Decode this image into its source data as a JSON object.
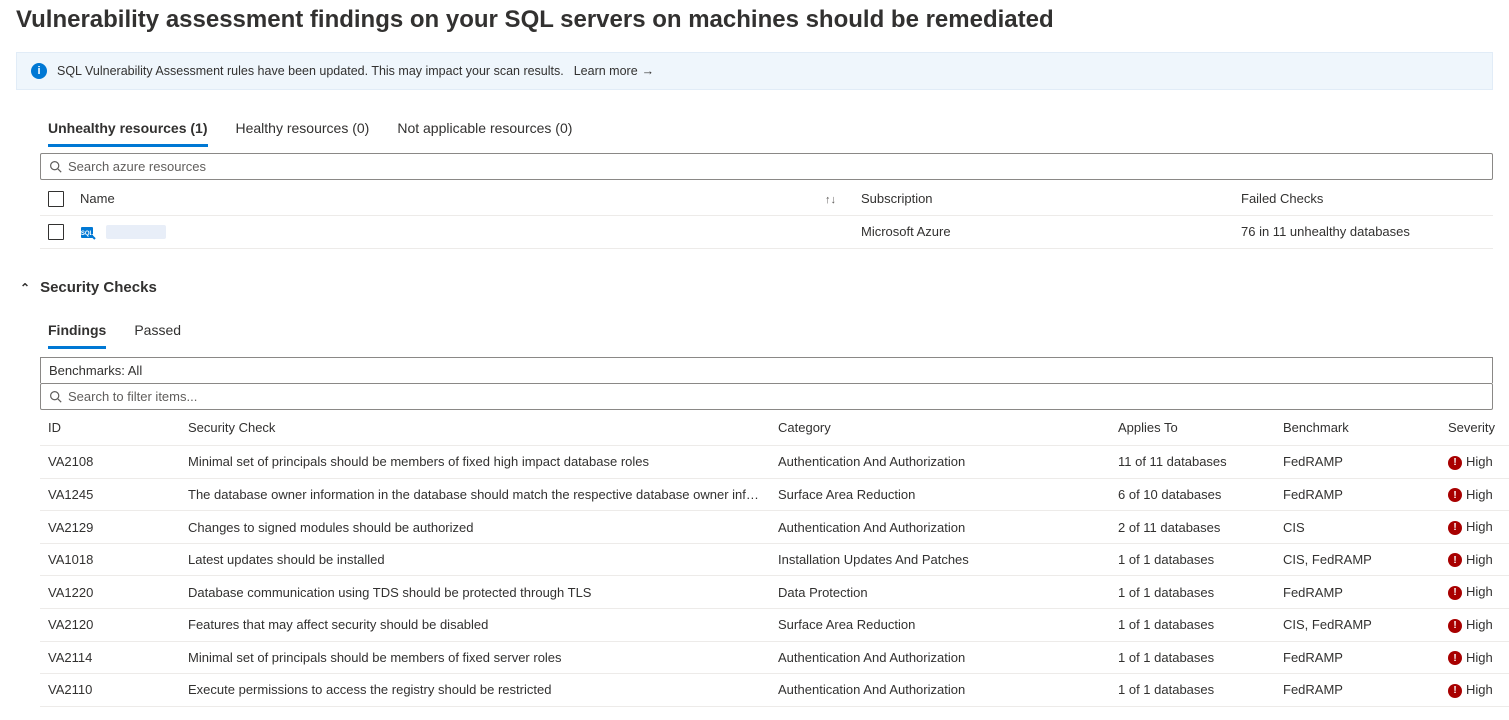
{
  "page_title": "Vulnerability assessment findings on your SQL servers on machines should be remediated",
  "info_banner": {
    "text": "SQL Vulnerability Assessment rules have been updated. This may impact your scan results.",
    "learn_more": "Learn more"
  },
  "resource_tabs": {
    "unhealthy": "Unhealthy resources (1)",
    "healthy": "Healthy resources (0)",
    "na": "Not applicable resources (0)"
  },
  "resource_search_placeholder": "Search azure resources",
  "resource_columns": {
    "name": "Name",
    "subscription": "Subscription",
    "failed": "Failed Checks"
  },
  "resource_row": {
    "subscription": "Microsoft Azure",
    "failed": "76 in 11 unhealthy databases"
  },
  "security_checks_heading": "Security Checks",
  "security_tabs": {
    "findings": "Findings",
    "passed": "Passed"
  },
  "benchmarks_label": "Benchmarks: All",
  "findings_search_placeholder": "Search to filter items...",
  "findings_columns": {
    "id": "ID",
    "security_check": "Security Check",
    "category": "Category",
    "applies_to": "Applies To",
    "benchmark": "Benchmark",
    "severity": "Severity"
  },
  "findings": [
    {
      "id": "VA2108",
      "security_check": "Minimal set of principals should be members of fixed high impact database roles",
      "category": "Authentication And Authorization",
      "applies_to": "11 of 11 databases",
      "benchmark": "FedRAMP",
      "severity": "High"
    },
    {
      "id": "VA1245",
      "security_check": "The database owner information in the database should match the respective database owner information in the target",
      "category": "Surface Area Reduction",
      "applies_to": "6 of 10 databases",
      "benchmark": "FedRAMP",
      "severity": "High"
    },
    {
      "id": "VA2129",
      "security_check": "Changes to signed modules should be authorized",
      "category": "Authentication And Authorization",
      "applies_to": "2 of 11 databases",
      "benchmark": "CIS",
      "severity": "High"
    },
    {
      "id": "VA1018",
      "security_check": "Latest updates should be installed",
      "category": "Installation Updates And Patches",
      "applies_to": "1 of 1 databases",
      "benchmark": "CIS, FedRAMP",
      "severity": "High"
    },
    {
      "id": "VA1220",
      "security_check": "Database communication using TDS should be protected through TLS",
      "category": "Data Protection",
      "applies_to": "1 of 1 databases",
      "benchmark": "FedRAMP",
      "severity": "High"
    },
    {
      "id": "VA2120",
      "security_check": "Features that may affect security should be disabled",
      "category": "Surface Area Reduction",
      "applies_to": "1 of 1 databases",
      "benchmark": "CIS, FedRAMP",
      "severity": "High"
    },
    {
      "id": "VA2114",
      "security_check": "Minimal set of principals should be members of fixed server roles",
      "category": "Authentication And Authorization",
      "applies_to": "1 of 1 databases",
      "benchmark": "FedRAMP",
      "severity": "High"
    },
    {
      "id": "VA2110",
      "security_check": "Execute permissions to access the registry should be restricted",
      "category": "Authentication And Authorization",
      "applies_to": "1 of 1 databases",
      "benchmark": "FedRAMP",
      "severity": "High"
    }
  ]
}
